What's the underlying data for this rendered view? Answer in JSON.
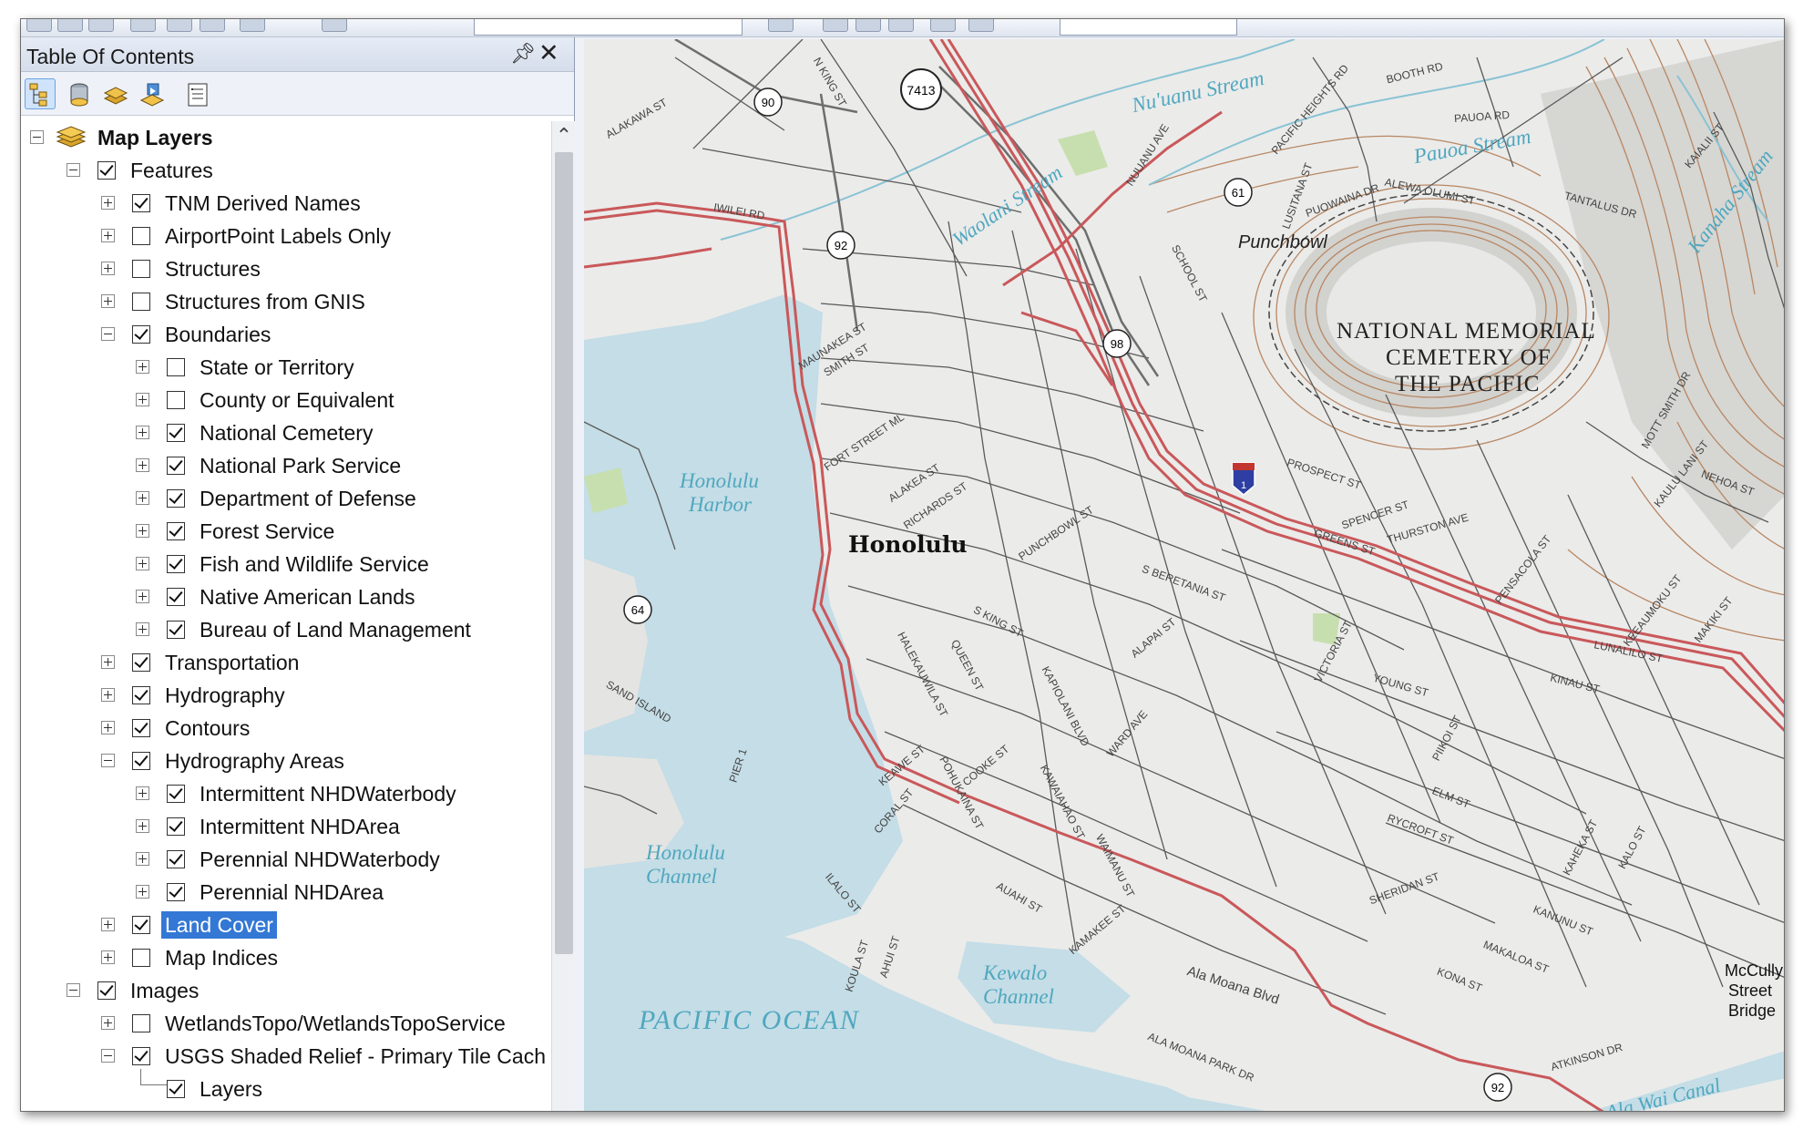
{
  "toc": {
    "title": "Table Of Contents",
    "pin_icon": "pin-icon",
    "close_icon": "close-icon",
    "toolbar_icons": [
      "list-by-drawing-order-icon",
      "list-by-source-icon",
      "list-by-visibility-icon",
      "list-by-selection-icon",
      "options-icon"
    ],
    "tree": {
      "map_layers": "Map Layers",
      "features": "Features",
      "tnm_derived_names": "TNM Derived Names",
      "airportpoint_labels": "AirportPoint Labels Only",
      "structures": "Structures",
      "structures_gnis": "Structures from GNIS",
      "boundaries": "Boundaries",
      "state_territory": "State or Territory",
      "county": "County or Equivalent",
      "national_cemetery": "National Cemetery",
      "national_park_service": "National Park Service",
      "department_of_defense": "Department of Defense",
      "forest_service": "Forest Service",
      "fish_wildlife": "Fish and Wildlife Service",
      "native_american": "Native American Lands",
      "blm": "Bureau of Land Management",
      "transportation": "Transportation",
      "hydrography": "Hydrography",
      "contours": "Contours",
      "hydrography_areas": "Hydrography Areas",
      "intermittent_nhdwaterbody": "Intermittent NHDWaterbody",
      "intermittent_nhdarea": "Intermittent NHDArea",
      "perennial_nhdwaterbody": "Perennial NHDWaterbody",
      "perennial_nhdarea": "Perennial NHDArea",
      "land_cover": "Land Cover",
      "map_indices": "Map Indices",
      "images": "Images",
      "wetlandstopo": "WetlandsTopo/WetlandsTopoService",
      "usgs_shaded_relief": "USGS Shaded Relief - Primary Tile Cach",
      "layers": "Layers"
    }
  },
  "map": {
    "place_names": {
      "honolulu": "Honolulu",
      "punchbowl": "Punchbowl",
      "cemetery_line1": "NATIONAL MEMORIAL",
      "cemetery_line2": "CEMETERY OF",
      "cemetery_line3": "THE PACIFIC",
      "pacific_ocean": "PACIFIC OCEAN",
      "harbor_line1": "Honolulu",
      "harbor_line2": "Harbor",
      "channel_line1": "Honolulu",
      "channel_line2": "Channel",
      "kewalo_line1": "Kewalo",
      "kewalo_line2": "Channel",
      "mccully_line1": "McCully",
      "mccully_line2": "Street",
      "mccully_line3": "Bridge"
    },
    "water_names": {
      "nuuanu": "Nu'uanu Stream",
      "pauoa": "Pauoa Stream",
      "waolani": "Waolani Stream",
      "kanaha": "Kanaha Stream",
      "alawai": "Ala Wai Canal"
    },
    "route_shields": {
      "r7413": "7413",
      "r90": "90",
      "r92a": "92",
      "r61": "61",
      "r98": "98",
      "r64": "64",
      "r92b": "92",
      "interstate": "1"
    },
    "street_labels": {
      "alakawa": "ALAKAWA ST",
      "iwilei": "IWILEI RD",
      "n_king": "N KING ST",
      "nuuanu_ave": "NUUANU AVE",
      "pacific_heights": "PACIFIC HEIGHTS RD",
      "booth": "BOOTH RD",
      "pauoa_rd": "PAUOA RD",
      "kaialii": "KAIALII ST",
      "puowaina": "PUOWAINA DR",
      "alewa": "ALEWA OLUMI ST",
      "tantalus": "TANTALUS DR",
      "school": "SCHOOL ST",
      "lusitana": "LUSITANA ST",
      "maunakea": "MAUNAKEA ST",
      "smith": "SMITH ST",
      "fort_street": "FORT STREET ML",
      "alakea": "ALAKEA ST",
      "richards": "RICHARDS ST",
      "punchbowl_st": "PUNCHBOWL ST",
      "beretania": "S BERETANIA ST",
      "king": "S KING ST",
      "alapai": "ALAPAI ST",
      "victoria": "VICTORIA ST",
      "prospect": "PROSPECT ST",
      "spencer": "SPENCER ST",
      "thurston": "THURSTON AVE",
      "greens": "GREENS ST",
      "lunalilo": "LUNALILO ST",
      "kinau": "KINAU ST",
      "young": "YOUNG ST",
      "pensacola": "PENSACOLA ST",
      "keeaumoku": "KEEAUMOKU ST",
      "makiki": "MAKIKI ST",
      "halekauwila": "HALEKAUWILA ST",
      "queen": "QUEEN ST",
      "kapiolani": "KAPIOLANI BLVD",
      "ward": "WARD AVE",
      "kawaiahao": "KAWAIAHAO ST",
      "waimanu": "WAIMANU ST",
      "auahi": "AUAHI ST",
      "kamakee": "KAMAKEE ST",
      "cooke": "COOKE ST",
      "keawe": "KEAWE ST",
      "pohukaina": "POHUKAINA ST",
      "coral": "CORAL ST",
      "ilalo": "ILALO ST",
      "koula": "KOULA ST",
      "ahui": "AHUI ST",
      "pier1": "PIER 1",
      "sand_island": "SAND ISLAND",
      "ala_moana": "Ala Moana Blvd",
      "ala_moana_park": "ALA MOANA PARK DR",
      "atkinson": "ATKINSON DR",
      "kona": "KONA ST",
      "kanunu": "KANUNU ST",
      "sheridan": "SHERIDAN ST",
      "rycroft": "RYCROFT ST",
      "elm": "ELM ST",
      "kaheka": "KAHEKA ST",
      "makaloa": "MAKALOA ST",
      "kalo": "KALO ST",
      "pi": "PIIKOI ST",
      "kaulu": "KAULU LANI ST",
      "nehoa": "NEHOA ST",
      "mott_smith": "MOTT SMITH DR"
    },
    "colors": {
      "land": "#ebebea",
      "water": "#c4dde6",
      "highway": "#c9585a",
      "contour": "#b88762",
      "street": "#555555"
    }
  }
}
